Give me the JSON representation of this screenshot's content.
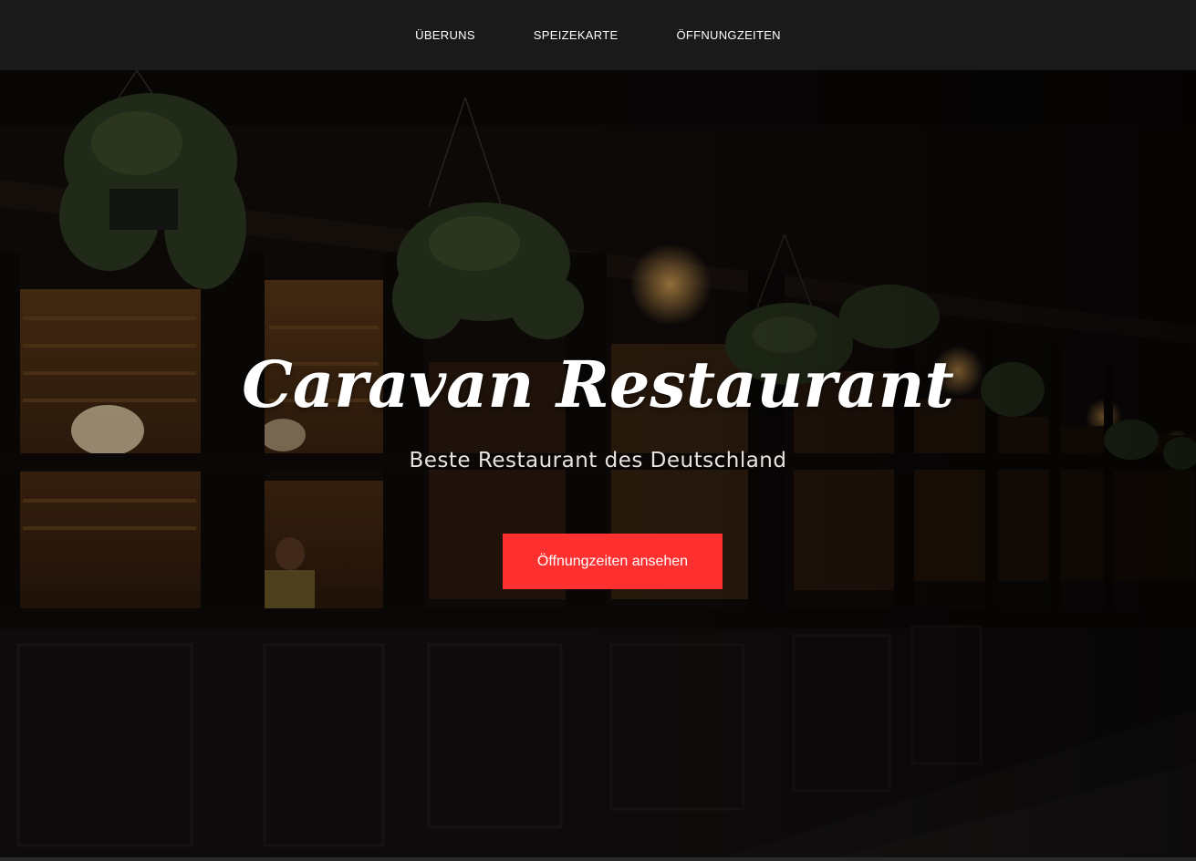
{
  "nav": {
    "items": [
      {
        "label": "ÜBERUNS"
      },
      {
        "label": "SPEIZEKARTE"
      },
      {
        "label": "ÖFFNUNGZEITEN"
      }
    ]
  },
  "hero": {
    "title": "Caravan Restaurant",
    "subtitle": "Beste Restaurant des Deutschland",
    "button_label": "Öffnungzeiten ansehen"
  },
  "colors": {
    "nav_background": "#1a1a1a",
    "button_accent": "#ff3030",
    "text": "#ffffff"
  }
}
